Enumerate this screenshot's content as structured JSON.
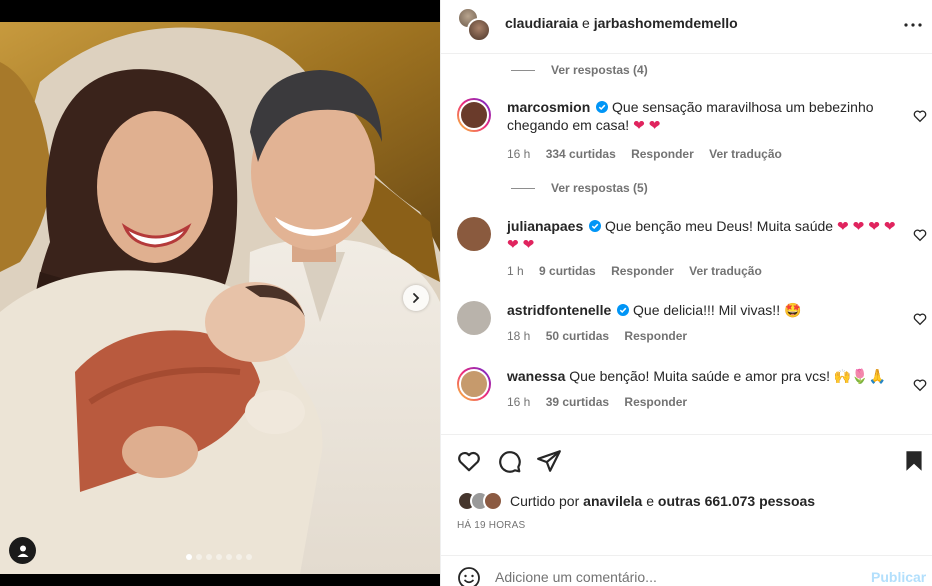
{
  "header": {
    "user1": "claudiaraia",
    "conjunction": "e",
    "user2": "jarbashomemdemello",
    "more_icon": "more-horizontal-icon"
  },
  "photo": {
    "carousel_total": 7,
    "carousel_active": 1,
    "next_icon": "chevron-right-icon",
    "tag_icon": "user-tag-icon"
  },
  "comments": {
    "replies_1": "Ver respostas (4)",
    "replies_2": "Ver respostas (5)",
    "items": [
      {
        "user": "marcosmion",
        "verified": true,
        "text": "Que sensação maravilhosa um bebezinho chegando em casa!",
        "emoji": "❤ ❤",
        "time": "16 h",
        "likes": "334 curtidas",
        "reply": "Responder",
        "translate": "Ver tradução",
        "avatar_color": "#6a3b2b"
      },
      {
        "user": "julianapaes",
        "verified": true,
        "text": "Que benção meu Deus! Muita saúde",
        "emoji": "❤ ❤ ❤ ❤ ❤ ❤",
        "time": "1 h",
        "likes": "9 curtidas",
        "reply": "Responder",
        "translate": "Ver tradução",
        "avatar_color": "#8a5a3e"
      },
      {
        "user": "astridfontenelle",
        "verified": true,
        "text": "Que delicia!!! Mil vivas!!",
        "emoji": "🤩",
        "time": "18 h",
        "likes": "50 curtidas",
        "reply": "Responder",
        "avatar_color": "#b9b3ab"
      },
      {
        "user": "wanessa",
        "verified": false,
        "text": "Que benção! Muita saúde e amor pra vcs!",
        "emoji": "🙌🌷🙏",
        "time": "16 h",
        "likes": "39 curtidas",
        "reply": "Responder",
        "avatar_color": "#c69a6c"
      }
    ]
  },
  "actions": {
    "liked_by_prefix": "Curtido por",
    "liked_by_user": "anavilela",
    "liked_by_and": "e",
    "liked_by_others": "outras 661.073 pessoas",
    "time_ago": "Há 19 horas"
  },
  "add_comment": {
    "placeholder": "Adicione um comentário...",
    "publish": "Publicar"
  },
  "colors": {
    "link_blue": "#0095f6",
    "publish_disabled": "#b2dffc",
    "verified_blue": "#0095f6",
    "heart_red": "#e0245e"
  }
}
